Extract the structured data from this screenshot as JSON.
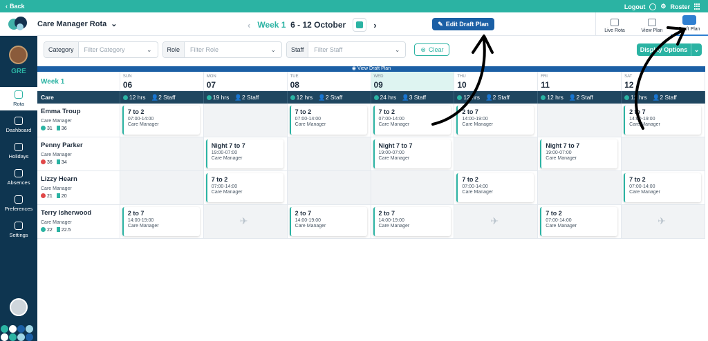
{
  "topbar": {
    "back_label": "Back",
    "logout_label": "Logout",
    "roster_label": "Roster"
  },
  "header": {
    "title": "Care Manager Rota",
    "week_label": "Week 1",
    "date_range": "6 - 12 October",
    "edit_button": "Edit Draft Plan",
    "view_tabs": [
      {
        "label": "Live Rota",
        "icon": "clipboard-icon",
        "active": false
      },
      {
        "label": "View Plan",
        "icon": "calendar-icon",
        "active": false
      },
      {
        "label": "Draft Plan",
        "icon": "pencil-icon",
        "active": true
      }
    ]
  },
  "sidebar": {
    "org": "GRE",
    "items": [
      {
        "label": "Rota",
        "icon": "calendar-icon",
        "active": true
      },
      {
        "label": "Dashboard",
        "icon": "dashboard-icon",
        "active": false
      },
      {
        "label": "Holidays",
        "icon": "holiday-icon",
        "active": false
      },
      {
        "label": "Absences",
        "icon": "absences-icon",
        "active": false
      },
      {
        "label": "Preferences",
        "icon": "preferences-icon",
        "active": false
      },
      {
        "label": "Settings",
        "icon": "gear-icon",
        "active": false
      }
    ]
  },
  "filters": {
    "category": {
      "label": "Category",
      "placeholder": "Filter Category"
    },
    "role": {
      "label": "Role",
      "placeholder": "Filter Role"
    },
    "staff": {
      "label": "Staff",
      "placeholder": "Filter Staff"
    },
    "clear_label": "Clear",
    "display_options_label": "Display Options"
  },
  "grid": {
    "banner": "View Draft Plan",
    "week_label": "Week 1",
    "section_label": "Care",
    "days": [
      {
        "name": "SUN",
        "num": "06",
        "hrs": "12 hrs",
        "staff": "2 Staff",
        "today": false
      },
      {
        "name": "MON",
        "num": "07",
        "hrs": "19 hrs",
        "staff": "2 Staff",
        "today": false
      },
      {
        "name": "TUE",
        "num": "08",
        "hrs": "12 hrs",
        "staff": "2 Staff",
        "today": false
      },
      {
        "name": "WED",
        "num": "09",
        "hrs": "24 hrs",
        "staff": "3 Staff",
        "today": true
      },
      {
        "name": "THU",
        "num": "10",
        "hrs": "12 hrs",
        "staff": "2 Staff",
        "today": false
      },
      {
        "name": "FRI",
        "num": "11",
        "hrs": "12 hrs",
        "staff": "2 Staff",
        "today": false
      },
      {
        "name": "SAT",
        "num": "12",
        "hrs": "12 hrs",
        "staff": "2 Staff",
        "today": false
      }
    ],
    "staff": [
      {
        "name": "Emma Troup",
        "role": "Care Manager",
        "stat1": "31",
        "stat2": "36",
        "stat1_color": "#2bb3a3",
        "shifts": [
          {
            "name": "7 to 2",
            "time": "07:00-14:00",
            "role": "Care Manager"
          },
          null,
          {
            "name": "7 to 2",
            "time": "07:00-14:00",
            "role": "Care Manager"
          },
          {
            "name": "7 to 2",
            "time": "07:00-14:00",
            "role": "Care Manager"
          },
          {
            "name": "2 to 7",
            "time": "14:00-19:00",
            "role": "Care Manager"
          },
          null,
          {
            "name": "2 to 7",
            "time": "14:00-19:00",
            "role": "Care Manager"
          }
        ]
      },
      {
        "name": "Penny Parker",
        "role": "Care Manager",
        "stat1": "36",
        "stat2": "34",
        "stat1_color": "#e04848",
        "shifts": [
          null,
          {
            "name": "Night 7 to 7",
            "time": "19:00-07:00",
            "role": "Care Manager"
          },
          null,
          {
            "name": "Night 7 to 7",
            "time": "19:00-07:00",
            "role": "Care Manager"
          },
          null,
          {
            "name": "Night 7 to 7",
            "time": "19:00-07:00",
            "role": "Care Manager"
          },
          null
        ]
      },
      {
        "name": "Lizzy Hearn",
        "role": "Care Manager",
        "stat1": "21",
        "stat2": "20",
        "stat1_color": "#e04848",
        "shifts": [
          null,
          {
            "name": "7 to 2",
            "time": "07:00-14:00",
            "role": "Care Manager"
          },
          null,
          null,
          {
            "name": "7 to 2",
            "time": "07:00-14:00",
            "role": "Care Manager"
          },
          null,
          {
            "name": "7 to 2",
            "time": "07:00-14:00",
            "role": "Care Manager"
          }
        ]
      },
      {
        "name": "Terry Isherwood",
        "role": "Care Manager",
        "stat1": "22",
        "stat2": "22.5",
        "stat1_color": "#2bb3a3",
        "shifts": [
          {
            "name": "2 to 7",
            "time": "14:00-19:00",
            "role": "Care Manager"
          },
          "holiday",
          {
            "name": "2 to 7",
            "time": "14:00-19:00",
            "role": "Care Manager"
          },
          {
            "name": "2 to 7",
            "time": "14:00-19:00",
            "role": "Care Manager"
          },
          "holiday",
          {
            "name": "7 to 2",
            "time": "07:00-14:00",
            "role": "Care Manager"
          },
          "holiday"
        ]
      }
    ]
  },
  "colors": {
    "accent": "#2bb3a3",
    "navy": "#0e3550",
    "primary_button": "#1b5fa5",
    "today_bg": "#def4f1"
  }
}
